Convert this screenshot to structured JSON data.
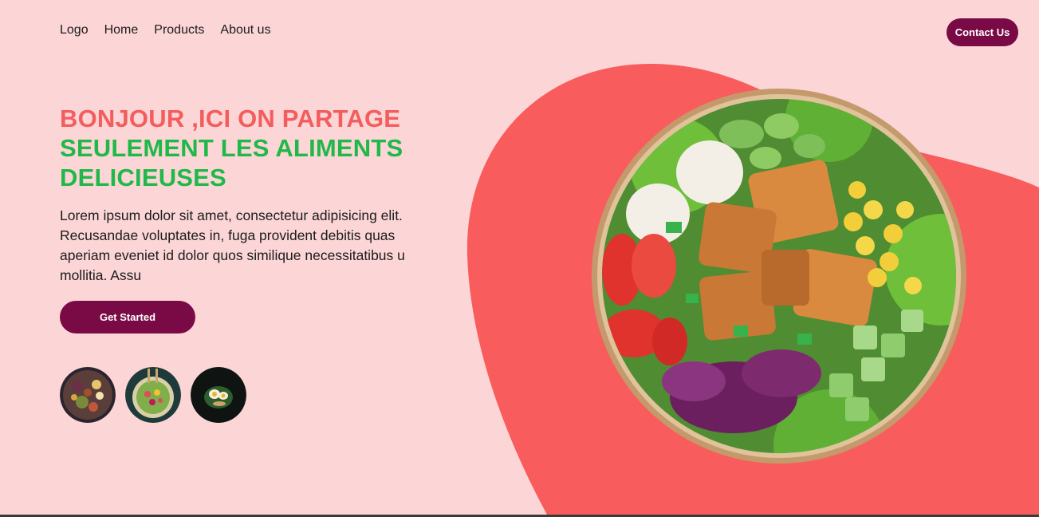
{
  "nav": {
    "logo": "Logo",
    "items": [
      {
        "label": "Home"
      },
      {
        "label": "Products"
      },
      {
        "label": "About us"
      }
    ],
    "contact_label": "Contact Us"
  },
  "hero": {
    "title_line1": "BONJOUR ,ICI ON PARTAGE",
    "title_line2": "SEULEMENT LES ALIMENTS DELICIEUSES",
    "text": "Lorem ipsum dolor sit amet, consectetur adipisicing elit. Recusandae voluptates in, fuga provident debitis quas aperiam eveniet id dolor quos similique necessitatibus u mollitia. Assu",
    "cta_label": "Get Started"
  },
  "thumbnails": [
    {
      "icon": "food-platter-image"
    },
    {
      "icon": "salad-bowl-image"
    },
    {
      "icon": "egg-dish-image"
    }
  ],
  "colors": {
    "background": "#fcd6d7",
    "blob": "#f95c5c",
    "title_red": "#f35d5d",
    "title_green": "#21b84a",
    "button": "#7a0a45"
  },
  "hero_image": {
    "icon": "salad-bowl-image"
  }
}
